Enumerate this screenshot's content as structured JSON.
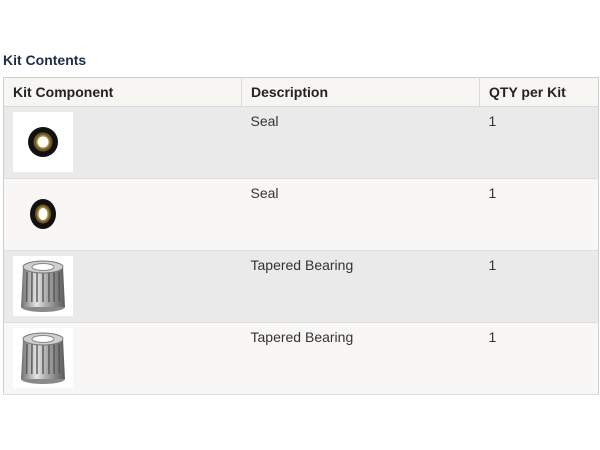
{
  "kit": {
    "title": "Kit Contents",
    "columns": {
      "component": "Kit Component",
      "description": "Description",
      "qty": "QTY per Kit"
    },
    "rows": [
      {
        "icon": "seal-icon",
        "description": "Seal",
        "qty": "1"
      },
      {
        "icon": "seal-icon",
        "description": "Seal",
        "qty": "1"
      },
      {
        "icon": "tapered-bearing-icon",
        "description": "Tapered Bearing",
        "qty": "1"
      },
      {
        "icon": "tapered-bearing-icon",
        "description": "Tapered Bearing",
        "qty": "1"
      }
    ]
  }
}
